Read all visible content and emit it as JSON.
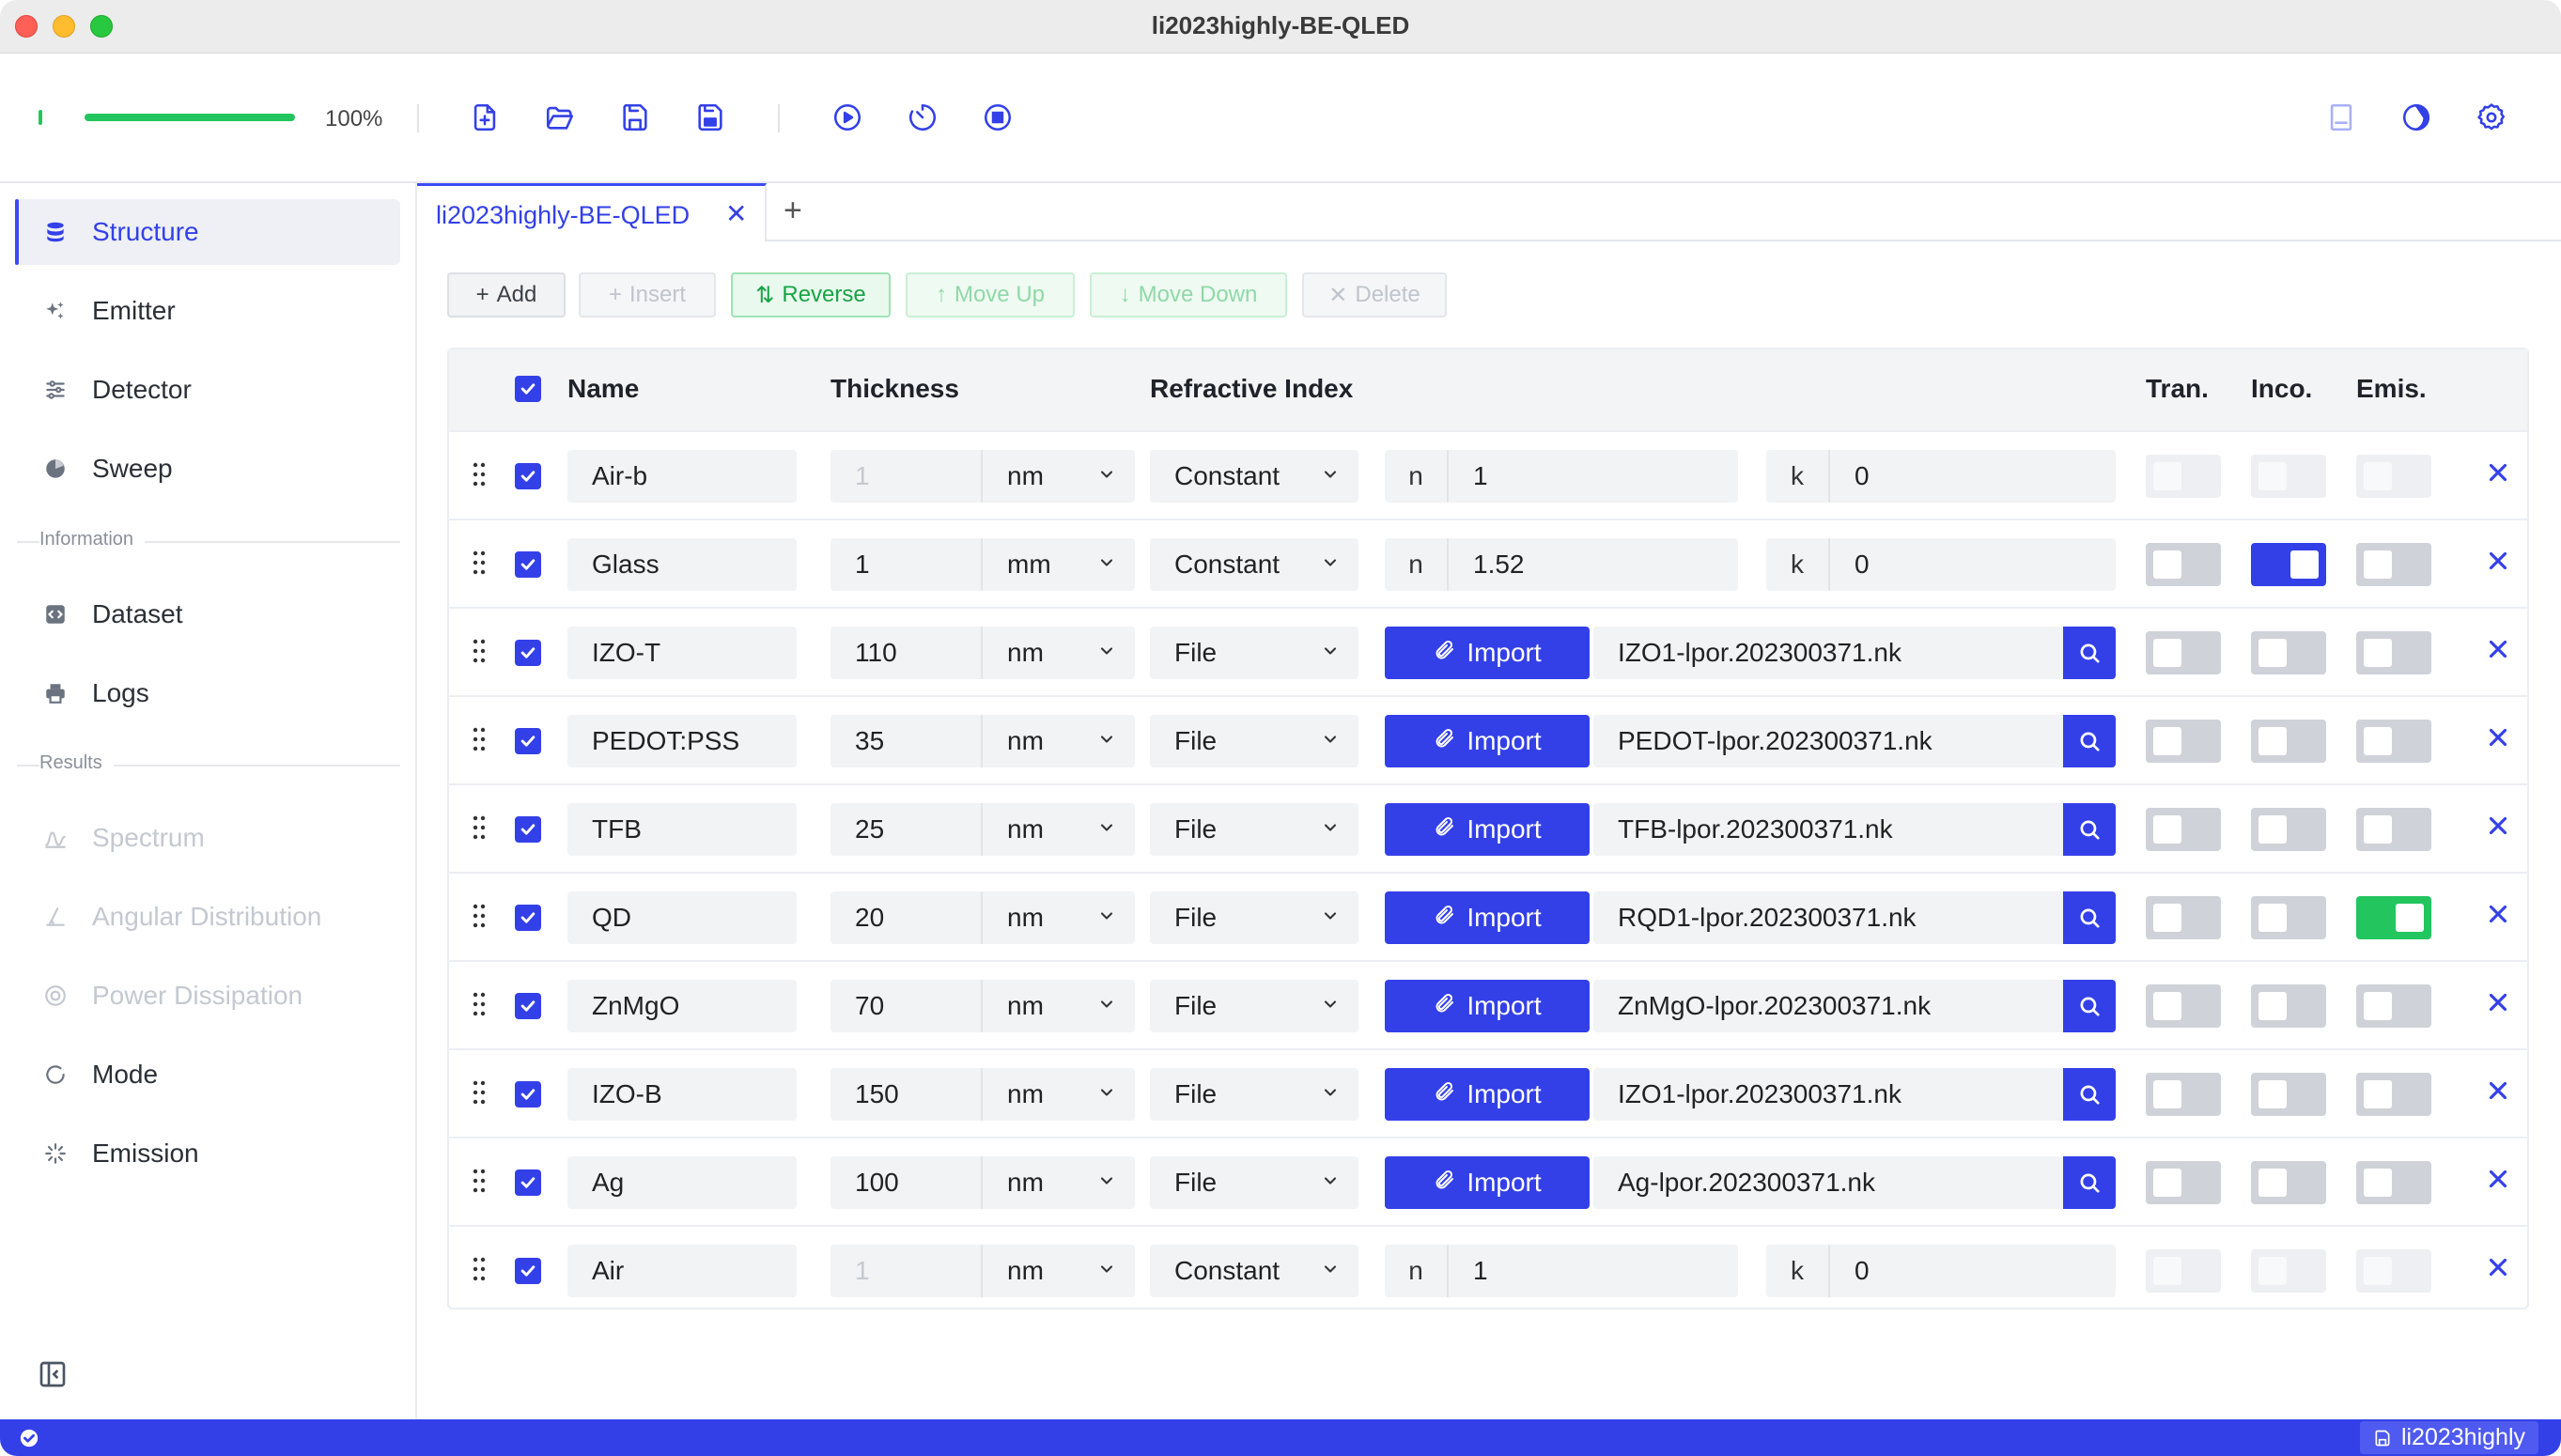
{
  "window": {
    "title": "li2023highly-BE-QLED"
  },
  "toolbar": {
    "progress_value": 1.0,
    "progress_label": "100%",
    "icons": [
      "new-file-icon",
      "open-folder-icon",
      "save-icon",
      "save-as-icon",
      "run-icon",
      "timer-icon",
      "stop-icon",
      "book-icon",
      "theme-icon",
      "settings-icon"
    ]
  },
  "sidebar": {
    "items": [
      {
        "label": "Structure",
        "icon": "database-icon",
        "active": true
      },
      {
        "label": "Emitter",
        "icon": "sparkles-icon"
      },
      {
        "label": "Detector",
        "icon": "sliders-icon"
      },
      {
        "label": "Sweep",
        "icon": "sweep-icon"
      }
    ],
    "info_section": "Information",
    "info_items": [
      {
        "label": "Dataset",
        "icon": "code-file-icon"
      },
      {
        "label": "Logs",
        "icon": "printer-icon"
      }
    ],
    "results_section": "Results",
    "results_items": [
      {
        "label": "Spectrum",
        "icon": "spectrum-icon",
        "disabled": true
      },
      {
        "label": "Angular Distribution",
        "icon": "angle-icon",
        "disabled": true
      },
      {
        "label": "Power Dissipation",
        "icon": "power-icon",
        "disabled": true
      },
      {
        "label": "Mode",
        "icon": "mode-icon"
      },
      {
        "label": "Emission",
        "icon": "emission-icon"
      }
    ]
  },
  "tabs": [
    {
      "label": "li2023highly-BE-QLED"
    }
  ],
  "actions": {
    "add": "Add",
    "insert": "Insert",
    "reverse": "Reverse",
    "move_up": "Move Up",
    "move_down": "Move Down",
    "delete": "Delete"
  },
  "table": {
    "headers": {
      "name": "Name",
      "thickness": "Thickness",
      "refractive_index": "Refractive Index",
      "tran": "Tran.",
      "inco": "Inco.",
      "emis": "Emis."
    },
    "n_label": "n",
    "k_label": "k",
    "import_label": "Import",
    "rows": [
      {
        "name": "Air-b",
        "thickness": "1",
        "unit": "nm",
        "mode": "Constant",
        "n": "1",
        "k": "0",
        "file": "",
        "tran": false,
        "inco": false,
        "emis": false,
        "locked": true
      },
      {
        "name": "Glass",
        "thickness": "1",
        "unit": "mm",
        "mode": "Constant",
        "n": "1.52",
        "k": "0",
        "file": "",
        "tran": false,
        "inco": true,
        "emis": false,
        "locked": false
      },
      {
        "name": "IZO-T",
        "thickness": "110",
        "unit": "nm",
        "mode": "File",
        "n": "",
        "k": "",
        "file": "IZO1-lpor.202300371.nk",
        "tran": false,
        "inco": false,
        "emis": false,
        "locked": false
      },
      {
        "name": "PEDOT:PSS",
        "thickness": "35",
        "unit": "nm",
        "mode": "File",
        "n": "",
        "k": "",
        "file": "PEDOT-lpor.202300371.nk",
        "tran": false,
        "inco": false,
        "emis": false,
        "locked": false
      },
      {
        "name": "TFB",
        "thickness": "25",
        "unit": "nm",
        "mode": "File",
        "n": "",
        "k": "",
        "file": "TFB-lpor.202300371.nk",
        "tran": false,
        "inco": false,
        "emis": false,
        "locked": false
      },
      {
        "name": "QD",
        "thickness": "20",
        "unit": "nm",
        "mode": "File",
        "n": "",
        "k": "",
        "file": "RQD1-lpor.202300371.nk",
        "tran": false,
        "inco": false,
        "emis": true,
        "locked": false
      },
      {
        "name": "ZnMgO",
        "thickness": "70",
        "unit": "nm",
        "mode": "File",
        "n": "",
        "k": "",
        "file": "ZnMgO-lpor.202300371.nk",
        "tran": false,
        "inco": false,
        "emis": false,
        "locked": false
      },
      {
        "name": "IZO-B",
        "thickness": "150",
        "unit": "nm",
        "mode": "File",
        "n": "",
        "k": "",
        "file": "IZO1-lpor.202300371.nk",
        "tran": false,
        "inco": false,
        "emis": false,
        "locked": false
      },
      {
        "name": "Ag",
        "thickness": "100",
        "unit": "nm",
        "mode": "File",
        "n": "",
        "k": "",
        "file": "Ag-lpor.202300371.nk",
        "tran": false,
        "inco": false,
        "emis": false,
        "locked": false
      },
      {
        "name": "Air",
        "thickness": "1",
        "unit": "nm",
        "mode": "Constant",
        "n": "1",
        "k": "0",
        "file": "",
        "tran": false,
        "inco": false,
        "emis": false,
        "locked": true
      }
    ]
  },
  "statusbar": {
    "project": "li2023highly"
  },
  "colors": {
    "accent": "#3340e8",
    "success": "#22c55e"
  }
}
